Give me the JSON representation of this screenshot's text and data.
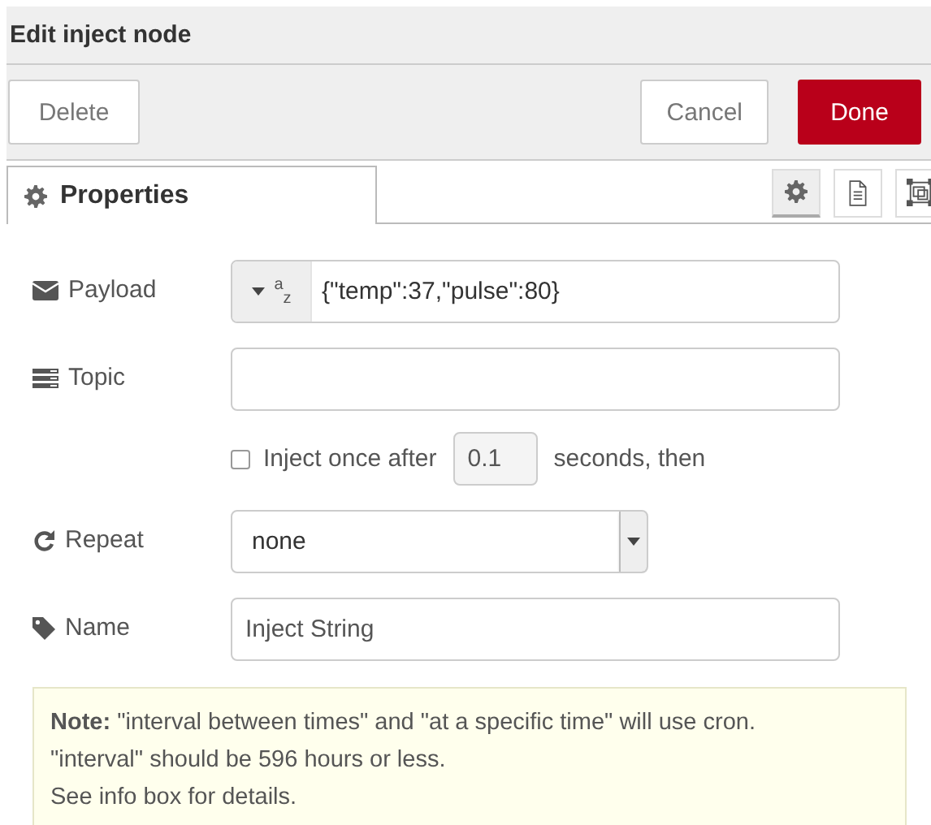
{
  "dialog": {
    "title": "Edit inject node"
  },
  "buttons": [
    {
      "label": "Delete",
      "kind": "plain"
    },
    {
      "label": "Cancel",
      "kind": "plain"
    },
    {
      "label": "Done",
      "kind": "primary"
    }
  ],
  "tabs": [
    {
      "label": "Properties",
      "selected": true
    }
  ],
  "side_tabs": [
    {
      "kind": "gear",
      "selected": true
    },
    {
      "kind": "document",
      "selected": false
    },
    {
      "kind": "frame",
      "selected": false
    }
  ],
  "fields": [
    {
      "kind": "typed",
      "label": "Payload",
      "type": "$^{a}$$_{z}$",
      "value": "{\"temp\":37,\"pulse\":80}"
    },
    {
      "kind": "text",
      "label": "Topic"
    },
    {
      "kind": "once",
      "checked": false,
      "before": "Inject once after",
      "value": "0.1",
      "after": "seconds, then"
    },
    {
      "kind": "select",
      "label": "Repeat",
      "value": "none"
    },
    {
      "kind": "text",
      "label": "Name",
      "value": "Inject String"
    }
  ],
  "note": "**Note:** \"interval between times\" and \"at a specific time\" will use cron.\n\"interval\" should be 596 hours or less.\nSee info box for details."
}
